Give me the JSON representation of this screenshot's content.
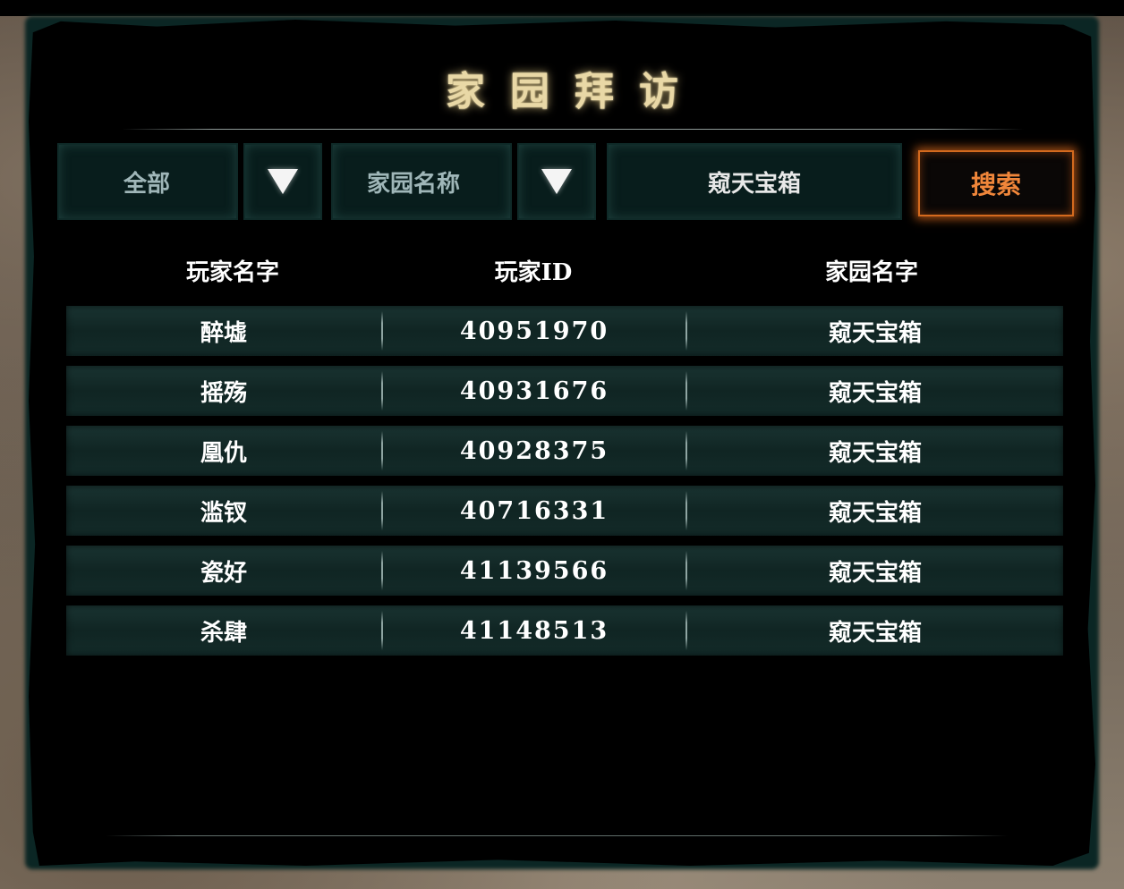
{
  "title": "家园拜访",
  "filters": {
    "scope_value": "全部",
    "field_value": "家园名称",
    "search_value": "窥天宝箱",
    "search_button_label": "搜索"
  },
  "table": {
    "headers": [
      "玩家名字",
      "玩家ID",
      "家园名字"
    ],
    "rows": [
      {
        "name": "醉墟",
        "id": "40951970",
        "home": "窥天宝箱"
      },
      {
        "name": "摇殇",
        "id": "40931676",
        "home": "窥天宝箱"
      },
      {
        "name": "凰仇",
        "id": "40928375",
        "home": "窥天宝箱"
      },
      {
        "name": "滥钗",
        "id": "40716331",
        "home": "窥天宝箱"
      },
      {
        "name": "瓷好",
        "id": "41139566",
        "home": "窥天宝箱"
      },
      {
        "name": "杀肆",
        "id": "41148513",
        "home": "窥天宝箱"
      }
    ]
  },
  "colors": {
    "title": "#e9d8a6",
    "accent": "#f0863a",
    "filter_text": "#9fb6b8",
    "row_bg": "#132b29"
  },
  "icons": {
    "dropdown": "triangle-down"
  }
}
